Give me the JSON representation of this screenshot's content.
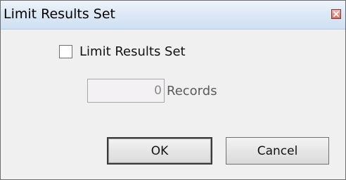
{
  "dialog": {
    "title": "Limit Results Set",
    "close_icon": "close-icon"
  },
  "limit_checkbox": {
    "label": "Limit Results Set",
    "checked": false
  },
  "records": {
    "value": "0",
    "label": "Records"
  },
  "buttons": {
    "ok_label": "OK",
    "cancel_label": "Cancel"
  }
}
